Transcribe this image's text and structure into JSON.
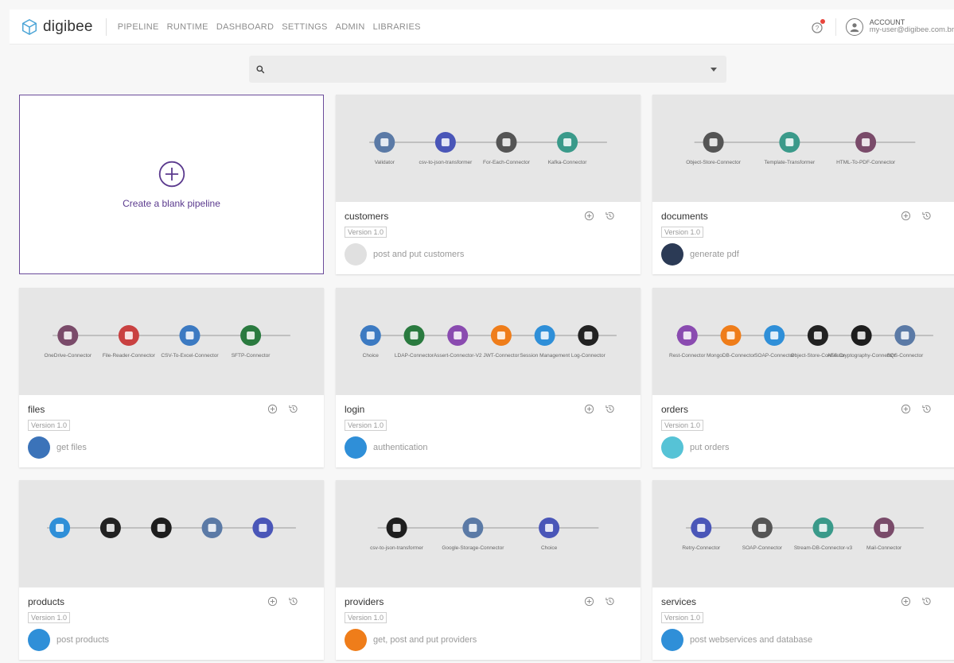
{
  "header": {
    "logo_text": "digibee",
    "nav": [
      "PIPELINE",
      "RUNTIME",
      "DASHBOARD",
      "SETTINGS",
      "ADMIN",
      "LIBRARIES"
    ],
    "account_label": "ACCOUNT",
    "account_email": "my-user@digibee.com.br"
  },
  "search": {
    "placeholder": ""
  },
  "blank": {
    "label": "Create a blank pipeline"
  },
  "cards": [
    {
      "title": "customers",
      "version": "Version 1.0",
      "description": "post and put customers",
      "icon_name": "kafka-icon",
      "icon_color": "#e0e0e0",
      "preview_labels": [
        "Validator",
        "csv-to-json-transformer",
        "For-Each-Connector",
        "Kafka-Connector"
      ]
    },
    {
      "title": "documents",
      "version": "Version 1.0",
      "description": "generate pdf",
      "icon_name": "rest-trigger-icon",
      "icon_color": "#2b3a55",
      "preview_labels": [
        "Object-Store-Connector",
        "Template-Transformer",
        "HTML-To-PDF-Connector"
      ]
    },
    {
      "title": "files",
      "version": "Version 1.0",
      "description": "get files",
      "icon_name": "email-trigger-icon",
      "icon_color": "#3b73b9",
      "preview_labels": [
        "OneDrive-Connector",
        "File-Reader-Connector",
        "CSV-To-Excel-Connector",
        "SFTP-Connector"
      ]
    },
    {
      "title": "login",
      "version": "Version 1.0",
      "description": "authentication",
      "icon_name": "api-trigger-icon",
      "icon_color": "#2f8fd8",
      "preview_labels": [
        "Choice",
        "LDAP-Connector",
        "Assert-Connector-V2",
        "JWT-Connector",
        "Session Management",
        "Log-Connector"
      ]
    },
    {
      "title": "orders",
      "version": "Version 1.0",
      "description": "put orders",
      "icon_name": "scheduler-trigger-icon",
      "icon_color": "#56c3d6",
      "preview_labels": [
        "Rest-Connector",
        "MongoDB-Connector",
        "SOAP-Connector",
        "Object-Store-Connector",
        "AES-Cryptography-Connector",
        "SQS-Connector"
      ]
    },
    {
      "title": "products",
      "version": "Version 1.0",
      "description": "post products",
      "icon_name": "api-trigger-icon",
      "icon_color": "#2f8fd8",
      "preview_labels": []
    },
    {
      "title": "providers",
      "version": "Version 1.0",
      "description": "get, post and put providers",
      "icon_name": "http-trigger-icon",
      "icon_color": "#ef7d1a",
      "preview_labels": [
        "csv-to-json-transformer",
        "Google-Storage-Connector",
        "Choice"
      ]
    },
    {
      "title": "services",
      "version": "Version 1.0",
      "description": "post webservices and database",
      "icon_name": "api-trigger-icon",
      "icon_color": "#2f8fd8",
      "preview_labels": [
        "Retry-Connector",
        "SOAP-Connector",
        "Stream-DB-Connector-v3",
        "Mail-Connector"
      ]
    }
  ]
}
